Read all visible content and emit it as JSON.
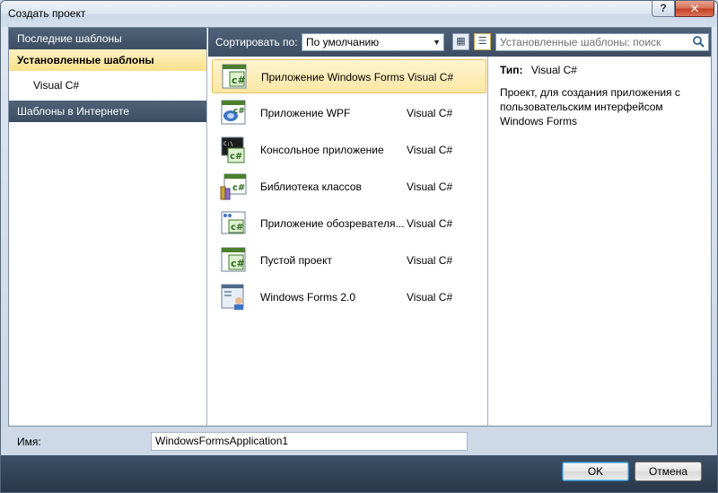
{
  "window": {
    "title": "Создать проект",
    "help_label": "?",
    "close_label": "✕"
  },
  "sidebar": {
    "items": [
      {
        "label": "Последние шаблоны"
      },
      {
        "label": "Установленные шаблоны"
      },
      {
        "label": "Visual C#"
      },
      {
        "label": "Шаблоны в Интернете"
      }
    ]
  },
  "toolbar": {
    "sort_label": "Сортировать по:",
    "sort_value": "По умолчанию",
    "search_placeholder": "Установленные шаблоны: поиск"
  },
  "templates": [
    {
      "name": "Приложение Windows Forms",
      "lang": "Visual C#",
      "icon": "winforms-csharp-icon",
      "selected": true
    },
    {
      "name": "Приложение WPF",
      "lang": "Visual C#",
      "icon": "wpf-icon"
    },
    {
      "name": "Консольное приложение",
      "lang": "Visual C#",
      "icon": "console-icon"
    },
    {
      "name": "Библиотека классов",
      "lang": "Visual C#",
      "icon": "class-library-icon"
    },
    {
      "name": "Приложение обозревателя...",
      "lang": "Visual C#",
      "icon": "browser-app-icon"
    },
    {
      "name": "Пустой проект",
      "lang": "Visual C#",
      "icon": "empty-project-icon"
    },
    {
      "name": "Windows Forms 2.0",
      "lang": "Visual C#",
      "icon": "winforms2-icon"
    }
  ],
  "info": {
    "type_label": "Тип:",
    "type_value": "Visual C#",
    "description": "Проект, для создания приложения с пользовательским интерфейсом Windows Forms"
  },
  "project": {
    "name_label": "Имя:",
    "name_value": "WindowsFormsApplication1"
  },
  "buttons": {
    "ok": "OK",
    "cancel": "Отмена"
  },
  "colors": {
    "nav_dark": "#3d4e63",
    "selection": "#fde7a4"
  }
}
